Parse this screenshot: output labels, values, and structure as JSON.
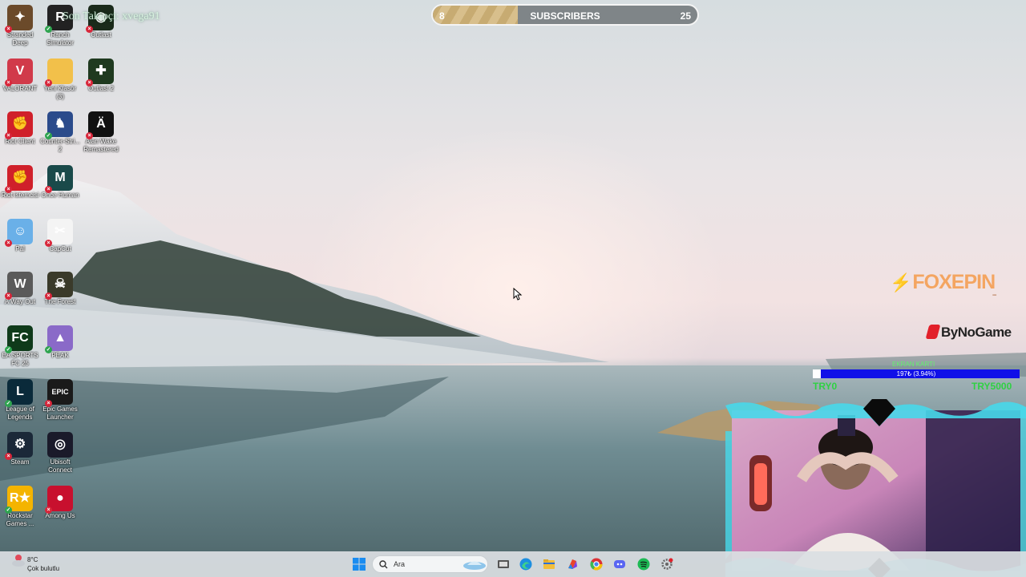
{
  "desktop_icons": [
    {
      "label": "Stranded Deep",
      "icon": "stranded-deep-icon",
      "color": "#6b4a2a",
      "glyph": "✦",
      "badge": "x"
    },
    {
      "label": "Ranch Simulator",
      "icon": "ranch-simulator-icon",
      "color": "#222222",
      "glyph": "R",
      "badge": "ok"
    },
    {
      "label": "Outlast",
      "icon": "outlast-icon",
      "color": "#1a2a1a",
      "glyph": "◉",
      "badge": "x"
    },
    {
      "label": "VALORANT",
      "icon": "valorant-icon",
      "color": "#d13a4a",
      "glyph": "V",
      "badge": "x"
    },
    {
      "label": "Yeni Klasör (3)",
      "icon": "folder-icon",
      "color": "#f2c04a",
      "glyph": "",
      "badge": "x"
    },
    {
      "label": "Outlast 2",
      "icon": "outlast-2-icon",
      "color": "#1f3a1f",
      "glyph": "✚",
      "badge": "x"
    },
    {
      "label": "Riot Client",
      "icon": "riot-client-icon",
      "color": "#d0202a",
      "glyph": "✊",
      "badge": "x"
    },
    {
      "label": "Counter-Stri... 2",
      "icon": "counter-strike-icon",
      "color": "#2b4b8b",
      "glyph": "♞",
      "badge": "ok"
    },
    {
      "label": "Alan Wake Remastered",
      "icon": "alan-wake-icon",
      "color": "#111111",
      "glyph": "Ä",
      "badge": "x"
    },
    {
      "label": "Riot istemcisi",
      "icon": "riot-istemcisi-icon",
      "color": "#d0202a",
      "glyph": "✊",
      "badge": "x"
    },
    {
      "label": "Once Human",
      "icon": "once-human-icon",
      "color": "#1a4a4a",
      "glyph": "M",
      "badge": "x"
    },
    {
      "label": "Pal",
      "icon": "palworld-icon",
      "color": "#6ab0e8",
      "glyph": "☺",
      "badge": "x"
    },
    {
      "label": "CapCut",
      "icon": "capcut-icon",
      "color": "#f4f4f4",
      "glyph": "✂",
      "badge": "x"
    },
    {
      "label": "A Way Out",
      "icon": "a-way-out-icon",
      "color": "#5a5a5a",
      "glyph": "W",
      "badge": "x"
    },
    {
      "label": "The Forest",
      "icon": "the-forest-icon",
      "color": "#3a3a2a",
      "glyph": "☠",
      "badge": "x"
    },
    {
      "label": "EA SPORTS FC 25",
      "icon": "ea-sports-fc-icon",
      "color": "#0f3a1a",
      "glyph": "FC",
      "badge": "ok"
    },
    {
      "label": "PEAK",
      "icon": "peak-icon",
      "color": "#8a6ac8",
      "glyph": "▲",
      "badge": "ok"
    },
    {
      "label": "League of Legends",
      "icon": "league-of-legends-icon",
      "color": "#0a2a3a",
      "glyph": "L",
      "badge": "ok"
    },
    {
      "label": "Epic Games Launcher",
      "icon": "epic-games-icon",
      "color": "#1a1a1a",
      "glyph": "EPIC",
      "badge": "x"
    },
    {
      "label": "Steam",
      "icon": "steam-icon",
      "color": "#1b2838",
      "glyph": "⚙",
      "badge": "x"
    },
    {
      "label": "Ubisoft Connect",
      "icon": "ubisoft-connect-icon",
      "color": "#1a1a2a",
      "glyph": "◎",
      "badge": ""
    },
    {
      "label": "Rockstar Games ...",
      "icon": "rockstar-games-icon",
      "color": "#f4b400",
      "glyph": "R★",
      "badge": "ok"
    },
    {
      "label": "Among Us",
      "icon": "among-us-icon",
      "color": "#c8102e",
      "glyph": "●",
      "badge": "x"
    }
  ],
  "stream_overlay": {
    "last_follower": "Son Takipçi: xvega91",
    "subscribers": {
      "label": "SUBSCRIBERS",
      "current": "8",
      "goal": "25",
      "progress": 0.32
    },
    "sponsor_1": "FOXEPIN",
    "sponsor_1_sub": "·······",
    "sponsor_2": "ByNoGame",
    "donation_goal": {
      "title": "EKRAN KARTI",
      "progress_text": "197₺ (3.94%)",
      "progress": 0.0394,
      "min_label": "TRY0",
      "max_label": "TRY5000"
    }
  },
  "taskbar": {
    "weather_temp": "8°C",
    "weather_desc": "Çok bulutlu",
    "search_placeholder": "Ara",
    "apps": [
      "windows-start-icon",
      "task-view-icon",
      "edge-icon",
      "file-explorer-icon",
      "microsoft-365-icon",
      "chrome-icon",
      "discord-icon",
      "spotify-icon",
      "settings-icon"
    ]
  },
  "colors": {
    "overlay_green": "#2fd143",
    "goal_blue": "#1010e8",
    "webcam_frame": "#47d8ea"
  }
}
